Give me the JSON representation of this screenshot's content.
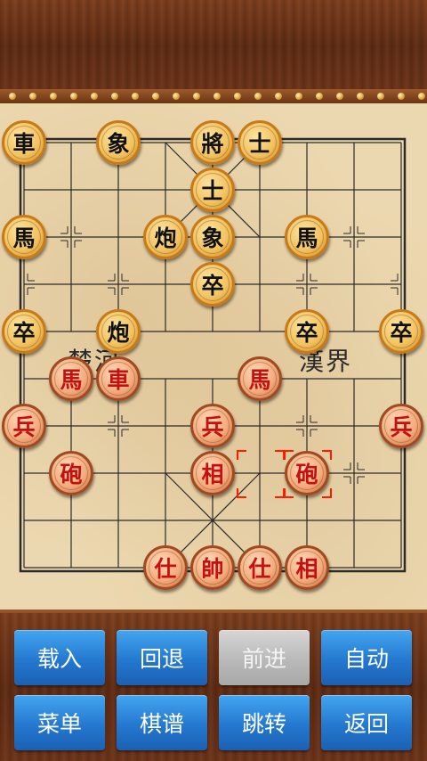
{
  "board": {
    "river_left": "楚河",
    "river_right": "漢界"
  },
  "pieces": [
    {
      "id": "b-chariot-1",
      "side": "black",
      "char": "車",
      "file": 0,
      "rank": 0
    },
    {
      "id": "b-elephant-1",
      "side": "black",
      "char": "象",
      "file": 2,
      "rank": 0
    },
    {
      "id": "b-general",
      "side": "black",
      "char": "將",
      "file": 4,
      "rank": 0
    },
    {
      "id": "b-advisor-1",
      "side": "black",
      "char": "士",
      "file": 5,
      "rank": 0
    },
    {
      "id": "b-advisor-2",
      "side": "black",
      "char": "士",
      "file": 4,
      "rank": 1
    },
    {
      "id": "b-horse-1",
      "side": "black",
      "char": "馬",
      "file": 0,
      "rank": 2
    },
    {
      "id": "b-cannon-1",
      "side": "black",
      "char": "炮",
      "file": 3,
      "rank": 2
    },
    {
      "id": "b-elephant-2",
      "side": "black",
      "char": "象",
      "file": 4,
      "rank": 2
    },
    {
      "id": "b-horse-2",
      "side": "black",
      "char": "馬",
      "file": 6,
      "rank": 2
    },
    {
      "id": "b-soldier-1",
      "side": "black",
      "char": "卒",
      "file": 4,
      "rank": 3
    },
    {
      "id": "b-soldier-2",
      "side": "black",
      "char": "卒",
      "file": 0,
      "rank": 4
    },
    {
      "id": "b-cannon-2",
      "side": "black",
      "char": "炮",
      "file": 2,
      "rank": 4
    },
    {
      "id": "b-soldier-3",
      "side": "black",
      "char": "卒",
      "file": 6,
      "rank": 4
    },
    {
      "id": "b-soldier-4",
      "side": "black",
      "char": "卒",
      "file": 8,
      "rank": 4
    },
    {
      "id": "r-horse-1",
      "side": "red",
      "char": "馬",
      "file": 1,
      "rank": 5
    },
    {
      "id": "r-chariot-1",
      "side": "red",
      "char": "車",
      "file": 2,
      "rank": 5
    },
    {
      "id": "r-horse-2",
      "side": "red",
      "char": "馬",
      "file": 5,
      "rank": 5
    },
    {
      "id": "r-soldier-1",
      "side": "red",
      "char": "兵",
      "file": 0,
      "rank": 6
    },
    {
      "id": "r-soldier-2",
      "side": "red",
      "char": "兵",
      "file": 4,
      "rank": 6
    },
    {
      "id": "r-soldier-3",
      "side": "red",
      "char": "兵",
      "file": 8,
      "rank": 6
    },
    {
      "id": "r-cannon-1",
      "side": "red",
      "char": "砲",
      "file": 1,
      "rank": 7
    },
    {
      "id": "r-elephant-1",
      "side": "red",
      "char": "相",
      "file": 4,
      "rank": 7
    },
    {
      "id": "r-cannon-2",
      "side": "red",
      "char": "砲",
      "file": 6,
      "rank": 7
    },
    {
      "id": "r-advisor-1",
      "side": "red",
      "char": "仕",
      "file": 3,
      "rank": 9
    },
    {
      "id": "r-general",
      "side": "red",
      "char": "帥",
      "file": 4,
      "rank": 9
    },
    {
      "id": "r-advisor-2",
      "side": "red",
      "char": "仕",
      "file": 5,
      "rank": 9
    },
    {
      "id": "r-elephant-2",
      "side": "red",
      "char": "相",
      "file": 6,
      "rank": 9
    }
  ],
  "last_move": {
    "from": {
      "file": 5,
      "rank": 7
    },
    "to": {
      "file": 6,
      "rank": 7
    }
  },
  "buttons": {
    "load": "载入",
    "undo": "回退",
    "redo": "前进",
    "auto": "自动",
    "menu": "菜单",
    "records": "棋谱",
    "jump": "跳转",
    "back": "返回"
  },
  "colors": {
    "board": "#ecd8b0",
    "button_blue": "#2478cf",
    "button_disabled": "#b9b9b9",
    "red_piece_text": "#c41010",
    "selection": "#ff1a00"
  }
}
